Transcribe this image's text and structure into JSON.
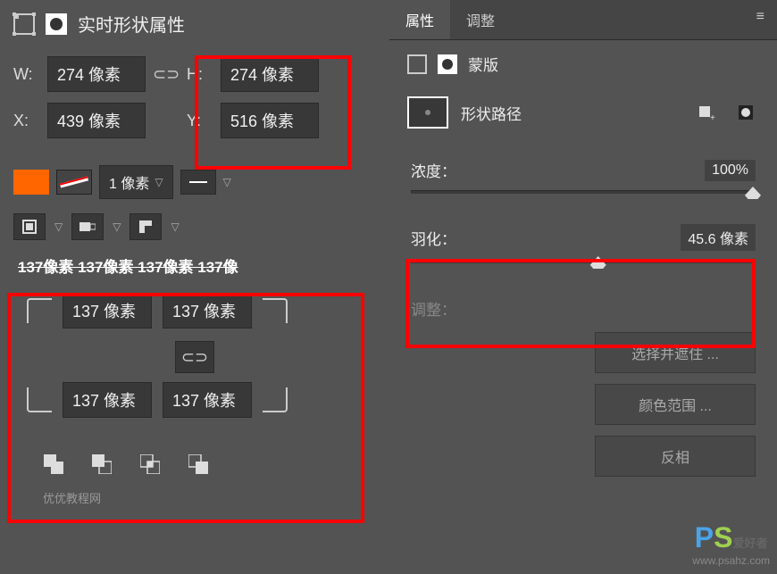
{
  "leftPanel": {
    "title": "实时形状属性",
    "w": {
      "label": "W:",
      "value": "274 像素"
    },
    "h": {
      "label": "H:",
      "value": "274 像素"
    },
    "x": {
      "label": "X:",
      "value": "439 像素"
    },
    "y": {
      "label": "Y:",
      "value": "516 像素"
    },
    "strokeWidth": "1 像素",
    "cornerLabels": "137像素 137像素 137像素 137像",
    "corners": {
      "tl": "137 像素",
      "tr": "137 像素",
      "bl": "137 像素",
      "br": "137 像素"
    },
    "caption": "优优教程网"
  },
  "rightPanel": {
    "tabs": {
      "properties": "属性",
      "adjust": "调整"
    },
    "maskTitle": "蒙版",
    "pathLabel": "形状路径",
    "density": {
      "label": "浓度：",
      "value": "100%"
    },
    "feather": {
      "label": "羽化：",
      "value": "45.6 像素"
    },
    "adjustLabel": "调整：",
    "buttons": {
      "selectMask": "选择并遮住 ...",
      "colorRange": "颜色范围 ...",
      "invert": "反相"
    },
    "watermark": {
      "sub": "爱好者",
      "url": "www.psahz.com"
    }
  }
}
